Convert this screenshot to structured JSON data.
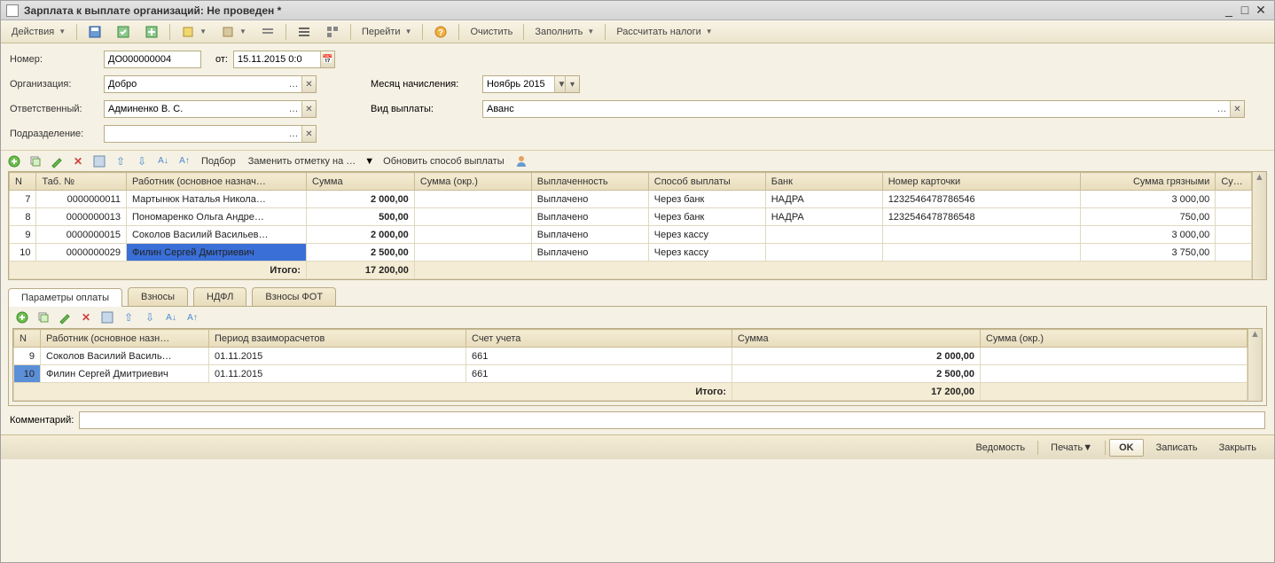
{
  "window": {
    "title": "Зарплата к выплате организаций: Не проведен *"
  },
  "toolbar": {
    "actions": "Действия",
    "goto": "Перейти",
    "clear": "Очистить",
    "fill": "Заполнить",
    "calc_taxes": "Рассчитать налоги"
  },
  "form": {
    "number_label": "Номер:",
    "number_value": "ДО000000004",
    "date_label": "от:",
    "date_value": "15.11.2015  0:0",
    "org_label": "Организация:",
    "org_value": "Добро",
    "month_label": "Месяц начисления:",
    "month_value": "Ноябрь 2015",
    "responsible_label": "Ответственный:",
    "responsible_value": "Админенко В. С.",
    "payment_type_label": "Вид выплаты:",
    "payment_type_value": "Аванс",
    "dept_label": "Подразделение:",
    "dept_value": ""
  },
  "table_toolbar": {
    "selection": "Подбор",
    "replace_mark": "Заменить отметку на …",
    "update_method": "Обновить способ выплаты"
  },
  "main_table": {
    "headers": {
      "n": "N",
      "tab": "Таб. №",
      "worker": "Работник (основное назнач…",
      "sum": "Сумма",
      "sum_okr": "Сумма (окр.)",
      "paid": "Выплаченность",
      "method": "Способ выплаты",
      "bank": "Банк",
      "card": "Номер карточки",
      "gross": "Сумма грязными",
      "su": "Су…"
    },
    "rows": [
      {
        "n": "7",
        "tab": "0000000011",
        "worker": "Мартынюк Наталья Никола…",
        "sum": "2 000,00",
        "sum_okr": "",
        "paid": "Выплачено",
        "method": "Через банк",
        "bank": "НАДРА",
        "card": "1232546478786546",
        "gross": "3 000,00"
      },
      {
        "n": "8",
        "tab": "0000000013",
        "worker": "Пономаренко Ольга Андре…",
        "sum": "500,00",
        "sum_okr": "",
        "paid": "Выплачено",
        "method": "Через банк",
        "bank": "НАДРА",
        "card": "1232546478786548",
        "gross": "750,00"
      },
      {
        "n": "9",
        "tab": "0000000015",
        "worker": "Соколов Василий Васильев…",
        "sum": "2 000,00",
        "sum_okr": "",
        "paid": "Выплачено",
        "method": "Через кассу",
        "bank": "",
        "card": "",
        "gross": "3 000,00"
      },
      {
        "n": "10",
        "tab": "0000000029",
        "worker": "Филин Сергей Дмитриевич",
        "sum": "2 500,00",
        "sum_okr": "",
        "paid": "Выплачено",
        "method": "Через кассу",
        "bank": "",
        "card": "",
        "gross": "3 750,00"
      }
    ],
    "totals_label": "Итого:",
    "totals_sum": "17 200,00"
  },
  "tabs": {
    "t1": "Параметры оплаты",
    "t2": "Взносы",
    "t3": "НДФЛ",
    "t4": "Взносы ФОТ"
  },
  "sub_table": {
    "headers": {
      "n": "N",
      "worker": "Работник (основное назн…",
      "period": "Период взаиморасчетов",
      "account": "Счет учета",
      "sum": "Сумма",
      "sum_okr": "Сумма (окр.)"
    },
    "rows": [
      {
        "n": "9",
        "worker": "Соколов Василий Василь…",
        "period": "01.11.2015",
        "account": "661",
        "sum": "2 000,00",
        "sum_okr": ""
      },
      {
        "n": "10",
        "worker": "Филин Сергей Дмитриевич",
        "period": "01.11.2015",
        "account": "661",
        "sum": "2 500,00",
        "sum_okr": ""
      }
    ],
    "totals_label": "Итого:",
    "totals_sum": "17 200,00"
  },
  "bottom": {
    "comment_label": "Комментарий:"
  },
  "footer": {
    "statement": "Ведомость",
    "print": "Печать",
    "ok": "OK",
    "save": "Записать",
    "close": "Закрыть"
  }
}
